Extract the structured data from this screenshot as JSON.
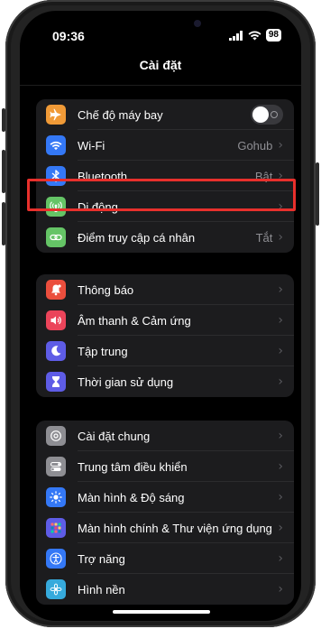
{
  "status_bar": {
    "time": "09:36",
    "battery": "98"
  },
  "header": {
    "title": "Cài đặt"
  },
  "groups": [
    {
      "rows": [
        {
          "label": "Chế độ máy bay",
          "value": "",
          "icon": "airplane-icon",
          "color": "#f09a37"
        },
        {
          "label": "Wi-Fi",
          "value": "Gohub",
          "icon": "wifi-icon",
          "color": "#3478f6"
        },
        {
          "label": "Bluetooth",
          "value": "Bật",
          "icon": "bluetooth-icon",
          "color": "#3478f6"
        },
        {
          "label": "Di động",
          "value": "",
          "icon": "antenna-icon",
          "color": "#65c466"
        },
        {
          "label": "Điểm truy cập cá nhân",
          "value": "Tắt",
          "icon": "link-icon",
          "color": "#65c466"
        }
      ]
    },
    {
      "rows": [
        {
          "label": "Thông báo",
          "icon": "bell-icon",
          "color": "#eb4e3d"
        },
        {
          "label": "Âm thanh & Cảm ứng",
          "icon": "speaker-icon",
          "color": "#eb445a"
        },
        {
          "label": "Tập trung",
          "icon": "moon-icon",
          "color": "#5e5ce6"
        },
        {
          "label": "Thời gian sử dụng",
          "icon": "hourglass-icon",
          "color": "#5e5ce6"
        }
      ]
    },
    {
      "rows": [
        {
          "label": "Cài đặt chung",
          "icon": "gear-icon",
          "color": "#8e8e93"
        },
        {
          "label": "Trung tâm điều khiển",
          "icon": "switches-icon",
          "color": "#8e8e93"
        },
        {
          "label": "Màn hình & Độ sáng",
          "icon": "sun-icon",
          "color": "#3478f6"
        },
        {
          "label": "Màn hình chính & Thư viện ứng dụng",
          "icon": "app-grid-icon",
          "color": "#5e5ce6"
        },
        {
          "label": "Trợ năng",
          "icon": "accessibility-icon",
          "color": "#3478f6"
        },
        {
          "label": "Hình nền",
          "icon": "flower-icon",
          "color": "#36aadc"
        }
      ]
    }
  ],
  "highlight_color": "#e8302c"
}
